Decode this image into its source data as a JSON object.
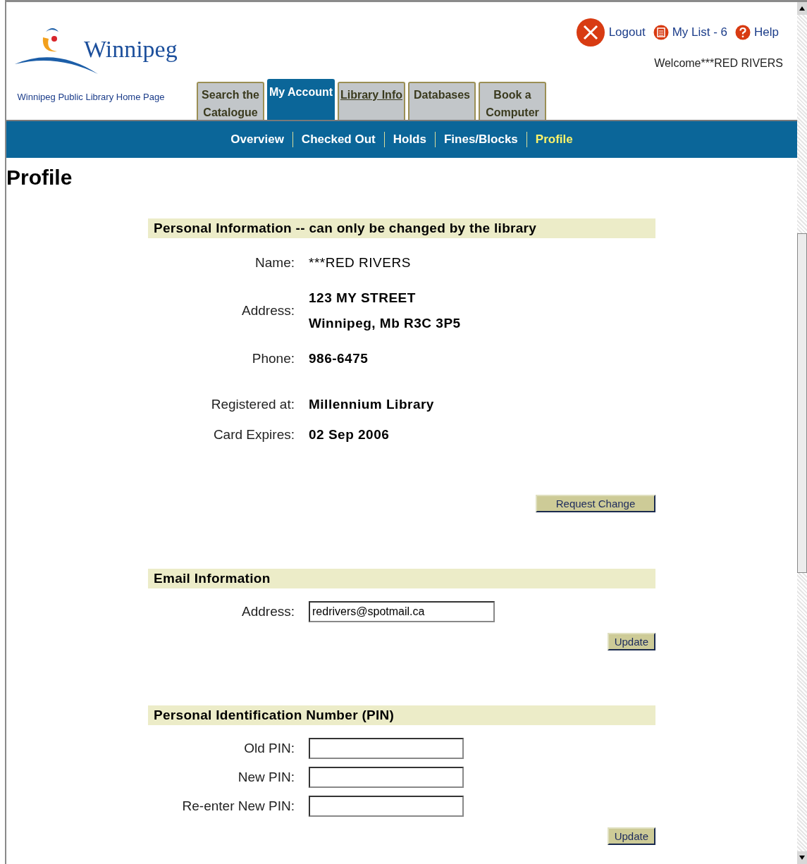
{
  "header": {
    "logo_text": "Winnipeg",
    "home_link": "Winnipeg Public Library Home Page",
    "top_links": [
      {
        "kind": "logout",
        "label": "Logout"
      },
      {
        "kind": "list",
        "label": "My List - 6"
      },
      {
        "kind": "help",
        "label": "Help"
      }
    ],
    "welcome": "Welcome***RED RIVERS"
  },
  "tabs": [
    {
      "label": "Search the Catalogue",
      "selected": false,
      "underlined": false
    },
    {
      "label": "My Account",
      "selected": true,
      "underlined": false
    },
    {
      "label": "Library Info",
      "selected": false,
      "underlined": true
    },
    {
      "label": "Databases",
      "selected": false,
      "underlined": false
    },
    {
      "label": "Book a Computer",
      "selected": false,
      "underlined": false
    }
  ],
  "subnav": [
    {
      "label": "Overview",
      "selected": false
    },
    {
      "label": "Checked Out",
      "selected": false
    },
    {
      "label": "Holds",
      "selected": false
    },
    {
      "label": "Fines/Blocks",
      "selected": false
    },
    {
      "label": "Profile",
      "selected": true
    }
  ],
  "page_title": "Profile",
  "sections": [
    {
      "kind": "info",
      "heading": "Personal Information -- can only be changed by the library",
      "fields": [
        {
          "label": "Name:",
          "values": [
            "***RED RIVERS"
          ]
        },
        {
          "label": "Address:",
          "values": [
            "123 MY STREET",
            "Winnipeg, Mb  R3C 3P5"
          ]
        },
        {
          "label": "Phone:",
          "values": [
            "986-6475"
          ]
        },
        {
          "label": "Registered at:",
          "values": [
            "Millennium Library"
          ]
        },
        {
          "label": "Card Expires:",
          "values": [
            "02 Sep 2006"
          ]
        }
      ],
      "button": "Request Change"
    },
    {
      "kind": "form",
      "heading": "Email Information",
      "fields": [
        {
          "label": "Address:",
          "value": "redrivers@spotmail.ca"
        }
      ],
      "button": "Update"
    },
    {
      "kind": "form",
      "heading": "Personal Identification Number (PIN)",
      "fields": [
        {
          "label": "Old PIN:"
        },
        {
          "label": "New PIN:"
        },
        {
          "label": "Re-enter New PIN:"
        }
      ],
      "button": "Update"
    }
  ]
}
